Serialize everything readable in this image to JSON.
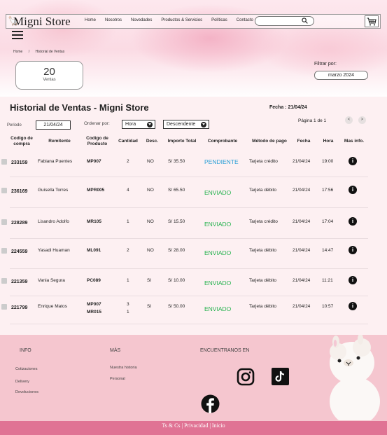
{
  "header": {
    "brand": "Migni Store",
    "nav": [
      "Home",
      "Nosotros",
      "Novedades",
      "Productos & Servicios",
      "Políticas",
      "Contacto"
    ],
    "search_placeholder": ""
  },
  "breadcrumb": [
    "Home",
    "/",
    "Historial de Ventas"
  ],
  "stat": {
    "value": "20",
    "label": "Ventas"
  },
  "filter": {
    "label": "Filtrar por:",
    "value": "marzo 2024"
  },
  "history": {
    "title": "Historial de Ventas - Migni Store",
    "date": "Fecha : 21/04/24",
    "periodo_label": "Periodo",
    "periodo_value": "21/04/24",
    "order_label": "Ordenar por:",
    "order_field": "Hora",
    "order_dir": "Descendente",
    "page": "Página 1 de 1",
    "prev": "<",
    "next": ">"
  },
  "columns": [
    "Codigo de compra",
    "Remitente",
    "Codigo de Producto",
    "Cantidad",
    "Desc.",
    "Importe Total",
    "Comprobante",
    "Método de pago",
    "Fecha",
    "Hora",
    "Mas info."
  ],
  "rows": [
    {
      "code": "233159",
      "sender": "Fabiana Puentes",
      "product": "MP007",
      "qty": "2",
      "desc": "NO",
      "total": "S/ 35.50",
      "status": "PENDIENTE",
      "status_color": "#2a9fd6",
      "payment": "Tarjeta crédito",
      "date": "21/04/24",
      "time": "19:00"
    },
    {
      "code": "236169",
      "sender": "Guisella Torres",
      "product": "MPR005",
      "qty": "4",
      "desc": "NO",
      "total": "S/ 65.50",
      "status": "ENVIADO",
      "status_color": "#22b14c",
      "payment": "Tarjeta débito",
      "date": "21/04/24",
      "time": "17:56"
    },
    {
      "code": "228289",
      "sender": "Lisandro Adolfo",
      "product": "MR105",
      "qty": "1",
      "desc": "NO",
      "total": "S/ 15.50",
      "status": "ENVIADO",
      "status_color": "#22b14c",
      "payment": "Tarjeta crédito",
      "date": "21/04/24",
      "time": "17:04"
    },
    {
      "code": "224559",
      "sender": "Yasadi Huaman",
      "product": "ML091",
      "qty": "2",
      "desc": "NO",
      "total": "S/ 28.00",
      "status": "ENVIADO",
      "status_color": "#22b14c",
      "payment": "Tarjeta débito",
      "date": "21/04/24",
      "time": "14:47"
    },
    {
      "code": "221359",
      "sender": "Vania Segura",
      "product": "PC089",
      "qty": "1",
      "desc": "SI",
      "total": "S/ 10.00",
      "status": "ENVIADO",
      "status_color": "#22b14c",
      "payment": "Tarjeta débito",
      "date": "21/04/24",
      "time": "11:21"
    },
    {
      "code": "221799",
      "sender": "Enrique Matos",
      "product": "MP007",
      "product2": "MR015",
      "qty": "3",
      "qty2": "1",
      "desc": "SI",
      "total": "S/ 50.00",
      "status": "ENVIADO",
      "status_color": "#22b14c",
      "payment": "Tarjeta débito",
      "date": "21/04/24",
      "time": "10:57"
    }
  ],
  "footer": {
    "info_title": "INFO",
    "info_links": [
      "Cotizaciones",
      "Delivery",
      "Devoluciones"
    ],
    "mas_title": "MÁS",
    "mas_links": [
      "Nuestra historia",
      "Personal"
    ],
    "social_title": "ENCUENTRANOS EN",
    "social_icons": [
      "instagram-icon",
      "tiktok-icon",
      "facebook-icon"
    ],
    "bottom": "Ts & Cs |  Privacidad  | Inicio"
  }
}
